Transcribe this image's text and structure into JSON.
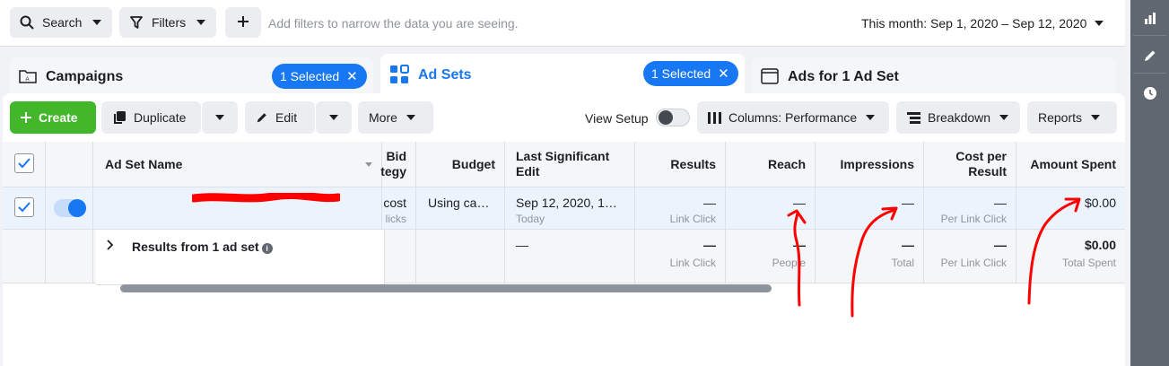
{
  "filter_bar": {
    "search_label": "Search",
    "filters_label": "Filters",
    "hint": "Add filters to narrow the data you are seeing.",
    "date_range": "This month: Sep 1, 2020 – Sep 12, 2020"
  },
  "tabs": [
    {
      "label": "Campaigns",
      "badge": "1 Selected",
      "icon": "campaign-folder-icon"
    },
    {
      "label": "Ad Sets",
      "badge": "1 Selected",
      "icon": "grid-icon"
    },
    {
      "label": "Ads for 1 Ad Set",
      "icon": "ad-window-icon"
    }
  ],
  "toolbar": {
    "create": "Create",
    "duplicate": "Duplicate",
    "edit": "Edit",
    "more": "More",
    "view_setup": "View Setup",
    "columns": "Columns: Performance",
    "breakdown": "Breakdown",
    "reports": "Reports"
  },
  "table": {
    "headers": {
      "name": "Ad Set Name",
      "bid_l1": "Bid",
      "bid_l2": "tegy",
      "budget": "Budget",
      "last_edit_l1": "Last Significant",
      "last_edit_l2": "Edit",
      "results": "Results",
      "reach": "Reach",
      "impressions": "Impressions",
      "cost_l1": "Cost per",
      "cost_l2": "Result",
      "amount": "Amount Spent"
    },
    "row": {
      "bid_main": "cost",
      "bid_sub": "licks",
      "budget": "Using ca…",
      "last_edit": "Sep 12, 2020, 1…",
      "last_edit_sub": "Today",
      "results": "—",
      "results_sub": "Link Click",
      "reach": "—",
      "impressions": "—",
      "cost": "—",
      "cost_sub": "Per Link Click",
      "amount": "$0.00"
    },
    "summary": {
      "label": "Results from 1 ad set",
      "last_edit": "—",
      "results": "—",
      "results_sub": "Link Click",
      "reach": "—",
      "reach_sub": "People",
      "impressions": "—",
      "impressions_sub": "Total",
      "cost": "—",
      "cost_sub": "Per Link Click",
      "amount": "$0.00",
      "amount_sub": "Total Spent"
    }
  },
  "rail_icons": [
    "chart-icon",
    "pencil-icon",
    "clock-icon"
  ],
  "colors": {
    "accent": "#1877f2",
    "create": "#42b72a",
    "annotation": "#ff0000"
  }
}
